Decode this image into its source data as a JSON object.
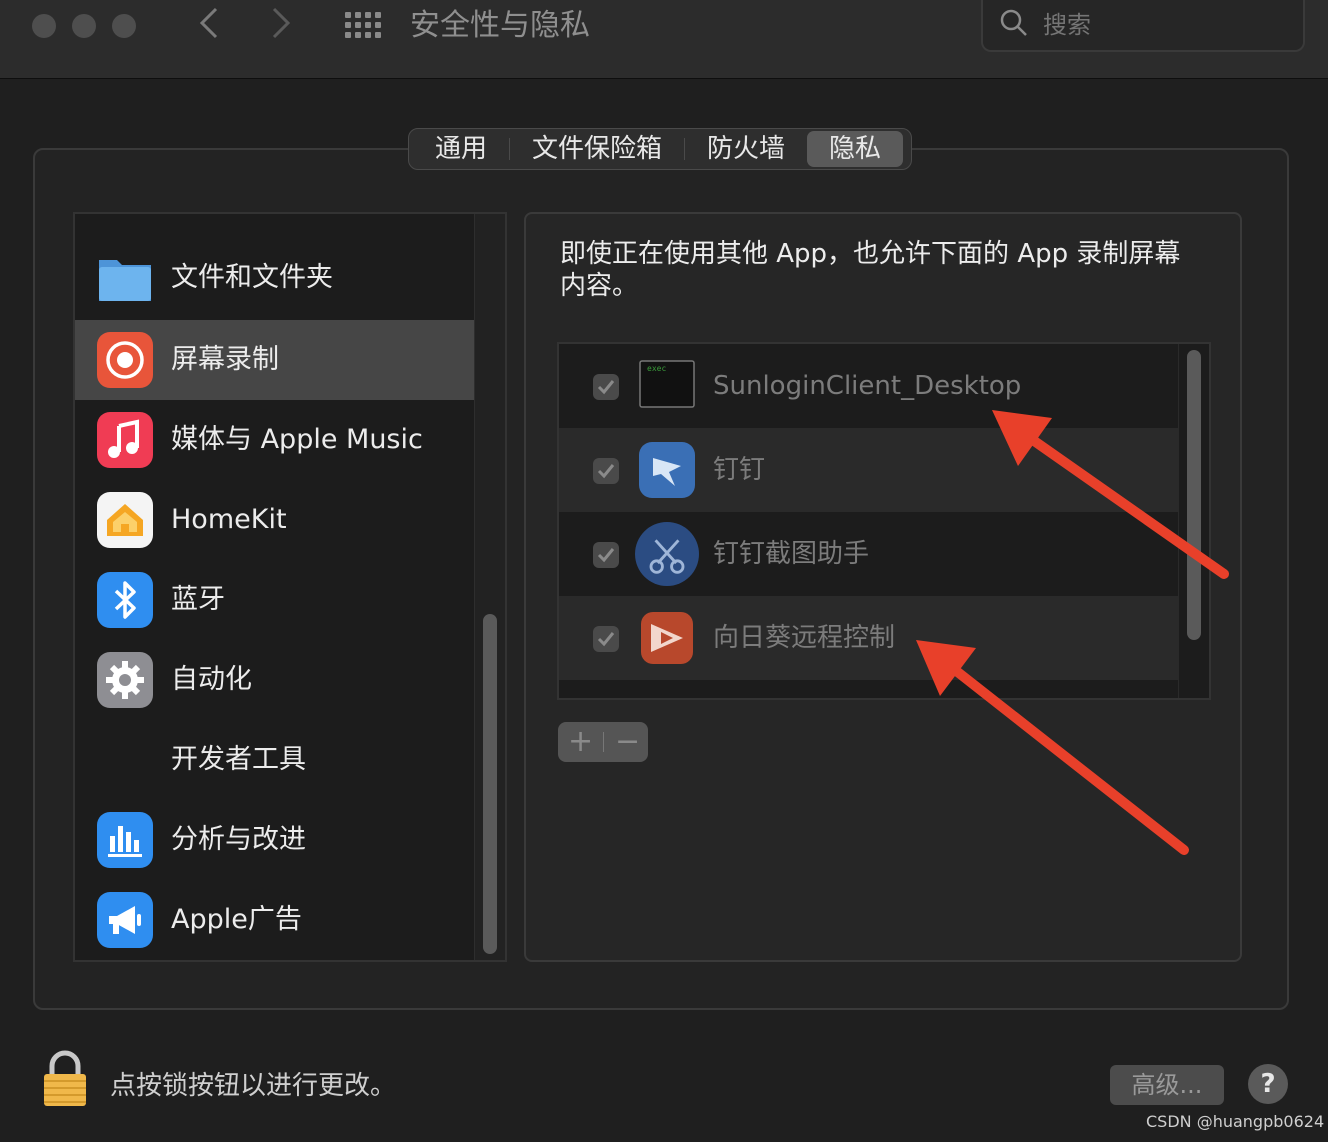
{
  "window": {
    "title": "安全性与隐私",
    "search_placeholder": "搜索"
  },
  "tabs": [
    {
      "label": "通用",
      "active": false
    },
    {
      "label": "文件保险箱",
      "active": false
    },
    {
      "label": "防火墙",
      "active": false
    },
    {
      "label": "隐私",
      "active": true
    }
  ],
  "sidebar": {
    "items": [
      {
        "label": "文件和文件夹",
        "icon": "folder-icon"
      },
      {
        "label": "屏幕录制",
        "icon": "screen-recording-icon",
        "selected": true
      },
      {
        "label": "媒体与 Apple Music",
        "icon": "music-icon"
      },
      {
        "label": "HomeKit",
        "icon": "home-icon"
      },
      {
        "label": "蓝牙",
        "icon": "bluetooth-icon"
      },
      {
        "label": "自动化",
        "icon": "gear-icon"
      },
      {
        "label": "开发者工具",
        "icon": ""
      },
      {
        "label": "分析与改进",
        "icon": "analytics-icon"
      },
      {
        "label": "Apple广告",
        "icon": "megaphone-icon"
      }
    ]
  },
  "main": {
    "description": "即使正在使用其他 App，也允许下面的 App 录制屏幕内容。",
    "apps": [
      {
        "name": "SunloginClient_Desktop",
        "checked": true,
        "icon": "terminal-exec-icon"
      },
      {
        "name": "钉钉",
        "checked": true,
        "icon": "dingtalk-icon"
      },
      {
        "name": "钉钉截图助手",
        "checked": true,
        "icon": "scissors-icon"
      },
      {
        "name": "向日葵远程控制",
        "checked": true,
        "icon": "sunlogin-icon"
      }
    ],
    "add_label": "+",
    "remove_label": "−"
  },
  "footer": {
    "lock_text": "点按锁按钮以进行更改。",
    "advanced_label": "高级...",
    "help_label": "?"
  },
  "watermark": "CSDN @huangpb0624",
  "colors": {
    "annotation_arrow": "#e8402a",
    "selected_row": "#464646"
  }
}
